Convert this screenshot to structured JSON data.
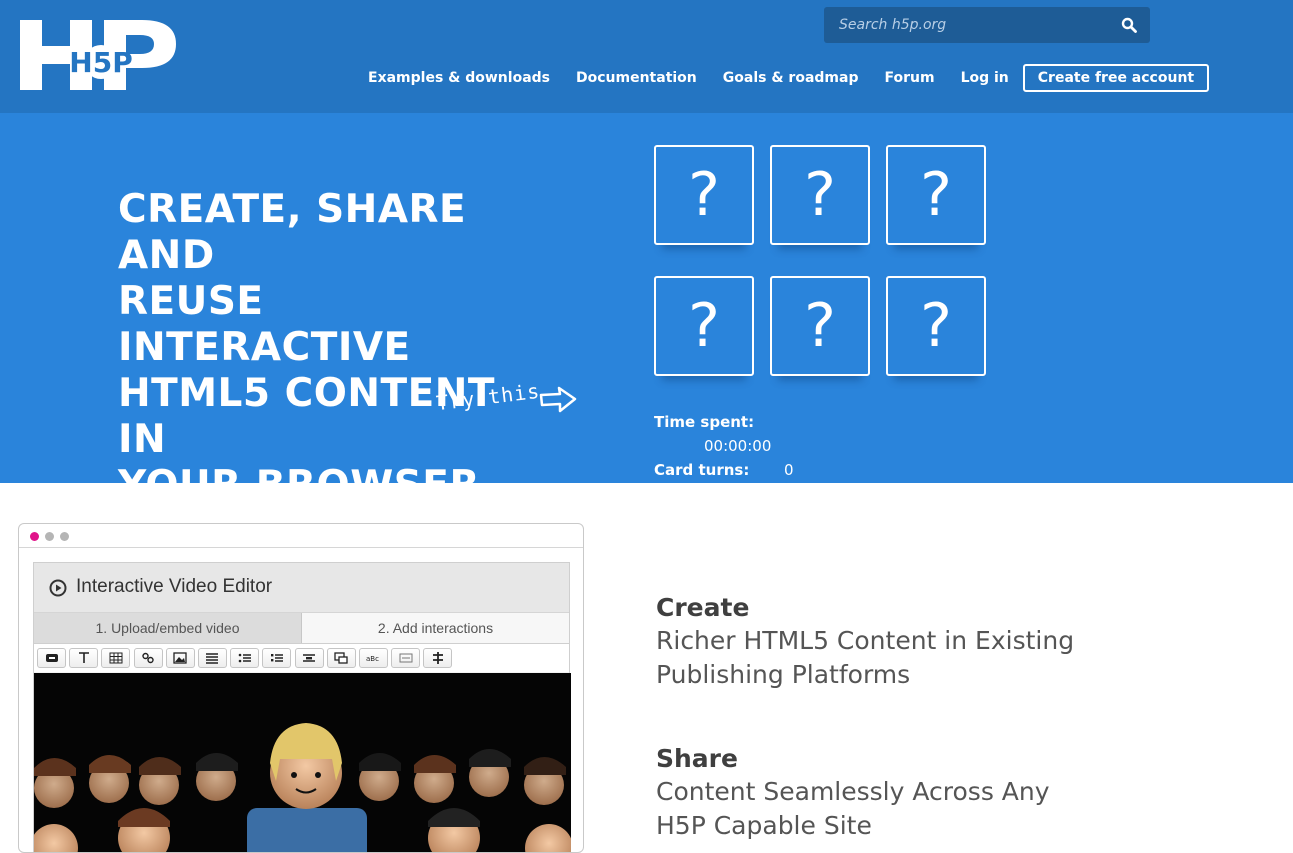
{
  "header": {
    "logo_text": "H5P",
    "search_placeholder": "Search h5p.org",
    "nav": [
      {
        "label": "Examples & downloads"
      },
      {
        "label": "Documentation"
      },
      {
        "label": "Goals & roadmap"
      },
      {
        "label": "Forum"
      },
      {
        "label": "Log in"
      },
      {
        "label": "Create free account"
      }
    ]
  },
  "hero": {
    "title_lines": [
      "CREATE, SHARE AND",
      "REUSE INTERACTIVE",
      "HTML5 CONTENT IN",
      "YOUR BROWSER"
    ],
    "try_label": "Try this",
    "cards": [
      "?",
      "?",
      "?",
      "?",
      "?",
      "?"
    ],
    "time_label": "Time spent:",
    "time_value": "00:00:00",
    "turns_label": "Card turns:",
    "turns_value": "0"
  },
  "editor": {
    "title": "Interactive Video Editor",
    "tabs": [
      "1. Upload/embed video",
      "2. Add interactions"
    ],
    "tool_icons": [
      "label-icon",
      "text-icon",
      "table-icon",
      "link-icon",
      "image-icon",
      "statements-icon",
      "single-choice-icon",
      "multi-choice-icon",
      "drag-text-icon",
      "summary-icon",
      "fill-blanks-icon",
      "mark-words-icon",
      "drag-drop-icon"
    ],
    "window_dot_colors": [
      "#e0148a",
      "#b5b5b5",
      "#b5b5b5"
    ]
  },
  "features": [
    {
      "title": "Create",
      "desc": "Richer HTML5 Content in Existing Publishing Platforms"
    },
    {
      "title": "Share",
      "desc": "Content Seamlessly Across Any H5P Capable Site"
    }
  ],
  "colors": {
    "header": "#2475c2",
    "hero": "#2a84db",
    "search_bg": "#1e5c96"
  }
}
